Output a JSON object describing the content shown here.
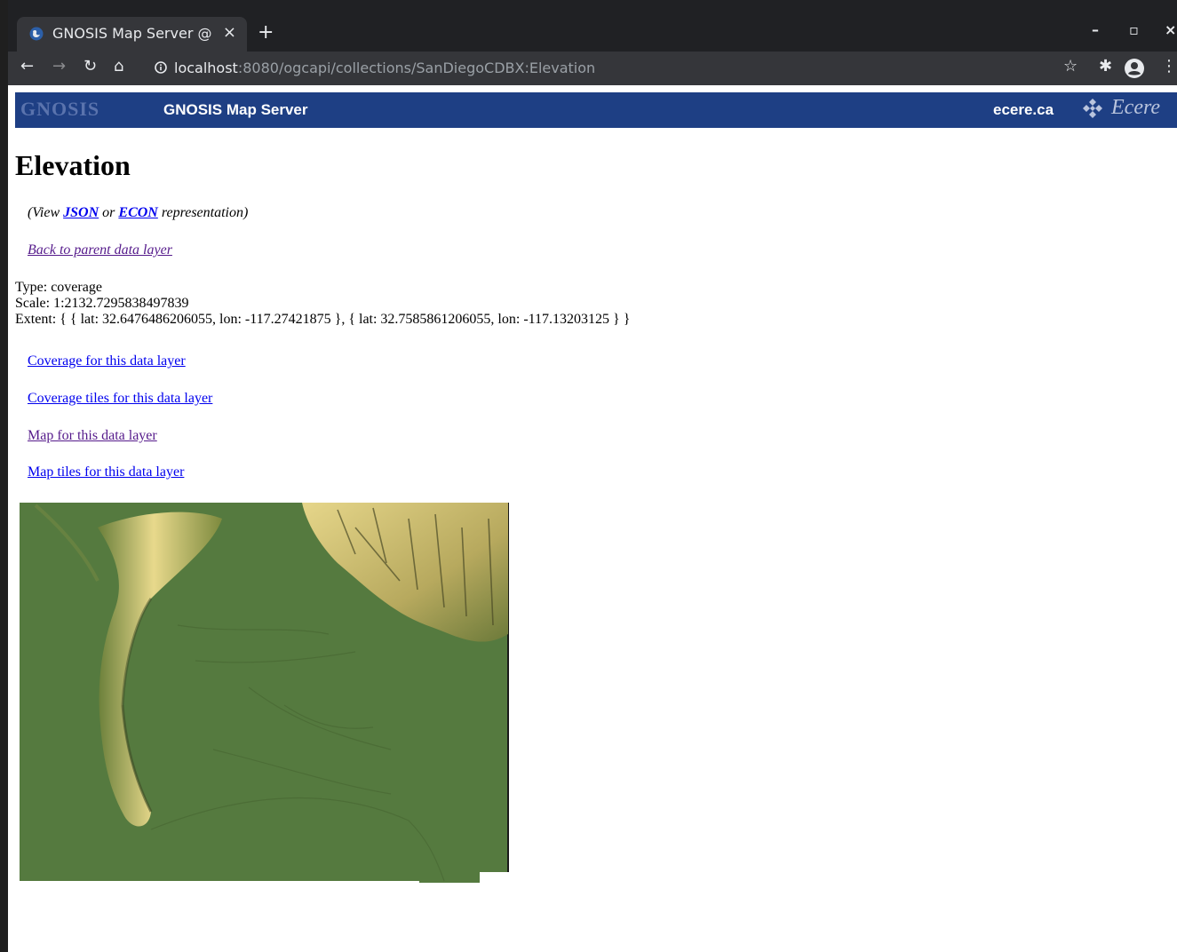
{
  "browser": {
    "tab_title": "GNOSIS Map Server @",
    "url_host": "localhost",
    "url_path": ":8080/ogcapi/collections/SanDiegoCDBX:Elevation",
    "icons": [
      "globe-favicon",
      "close-icon",
      "plus-icon",
      "minimize-icon",
      "maximize-icon",
      "close-window-icon",
      "back-arrow-icon",
      "forward-arrow-icon",
      "reload-icon",
      "home-icon",
      "info-icon",
      "star-icon",
      "puzzle-icon",
      "profile-icon",
      "kebab-menu-icon"
    ]
  },
  "header": {
    "logo_text": "GNOSIS",
    "title": "GNOSIS Map Server",
    "site_link": "ecere.ca",
    "partner_logo": "Ecere",
    "background": "#1e3f84"
  },
  "page": {
    "heading": "Elevation",
    "representation": {
      "prefix": "(View",
      "json_label": "JSON",
      "middle": "or",
      "econ_label": "ECON",
      "suffix": "representation)"
    },
    "back_link": "Back to parent data layer",
    "info": {
      "type": "Type: coverage",
      "scale": "Scale: 1:2132.7295838497839",
      "extent": "Extent: { { lat: 32.6476486206055, lon: -117.27421875 }, { lat: 32.7585861206055, lon: -117.13203125 } }"
    },
    "links": [
      "Coverage for this data layer",
      "Coverage tiles for this data layer",
      "Map for this data layer",
      "Map tiles for this data layer"
    ],
    "link_color": "#0000ee",
    "visited_color": "#551a8b"
  },
  "map_image": {
    "subject": "San Diego elevation hillshade",
    "lowland_color": "#557a3f",
    "highland_color": "#e8d98c"
  }
}
